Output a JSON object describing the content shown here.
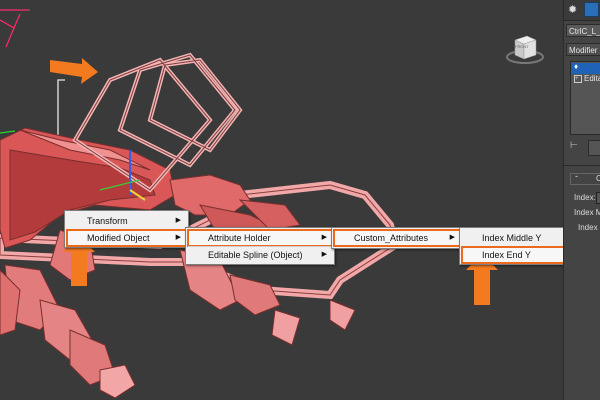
{
  "viewcube": {
    "label": "FRONT"
  },
  "context_menu": {
    "level1": [
      {
        "label": "Transform",
        "has_submenu": true
      },
      {
        "label": "Modified Object",
        "has_submenu": true
      }
    ],
    "level2": [
      {
        "label": "Attribute Holder",
        "has_submenu": true
      },
      {
        "label": "Editable Spline (Object)",
        "has_submenu": true
      }
    ],
    "level3": [
      {
        "label": "Custom_Attributes",
        "has_submenu": true
      }
    ],
    "level4": [
      {
        "label": "Index Middle Y"
      },
      {
        "label": "Index End Y"
      }
    ]
  },
  "command_panel": {
    "object_name": "CtrlC_L_",
    "modifier_list": "Modifier",
    "stack_item_2": "Edita",
    "rollout_marker": "C",
    "params": [
      "Index:",
      "Index M",
      "Index"
    ]
  },
  "colors": {
    "highlight_outline": "#ec6a1d",
    "arrow": "#f47a20",
    "selection": "#e87b7b",
    "viewport_bg": "#3a3a3a"
  }
}
